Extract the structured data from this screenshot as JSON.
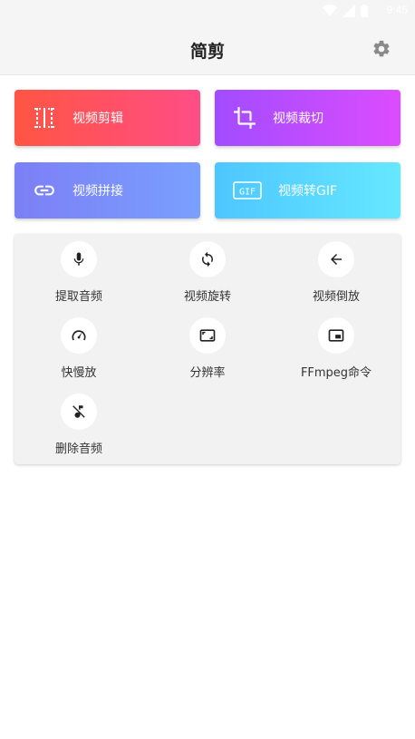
{
  "status_bar": {
    "time": "9:45",
    "icons": [
      "wifi-icon",
      "signal-icon",
      "battery-icon"
    ]
  },
  "app_bar": {
    "title": "简剪",
    "settings_icon": "gear-icon"
  },
  "cards": [
    {
      "label": "视频剪辑",
      "icon": "video-cut-icon",
      "colors": [
        "#ff5543",
        "#ff4d86"
      ]
    },
    {
      "label": "视频裁切",
      "icon": "crop-icon",
      "colors": [
        "#a24cff",
        "#dc4cff"
      ]
    },
    {
      "label": "视频拼接",
      "icon": "link-icon",
      "colors": [
        "#7c7ff5",
        "#7aa0ff"
      ]
    },
    {
      "label": "视频转GIF",
      "icon": "gif-icon",
      "colors": [
        "#4dc6ff",
        "#66e8ff"
      ]
    }
  ],
  "tools": [
    {
      "label": "提取音频",
      "icon": "mic-icon"
    },
    {
      "label": "视频旋转",
      "icon": "rotate-icon"
    },
    {
      "label": "视频倒放",
      "icon": "arrow-left-icon"
    },
    {
      "label": "快慢放",
      "icon": "speedometer-icon"
    },
    {
      "label": "分辨率",
      "icon": "aspect-ratio-icon"
    },
    {
      "label": "FFmpeg命令",
      "icon": "picture-in-picture-icon"
    },
    {
      "label": "删除音频",
      "icon": "music-off-icon"
    }
  ]
}
